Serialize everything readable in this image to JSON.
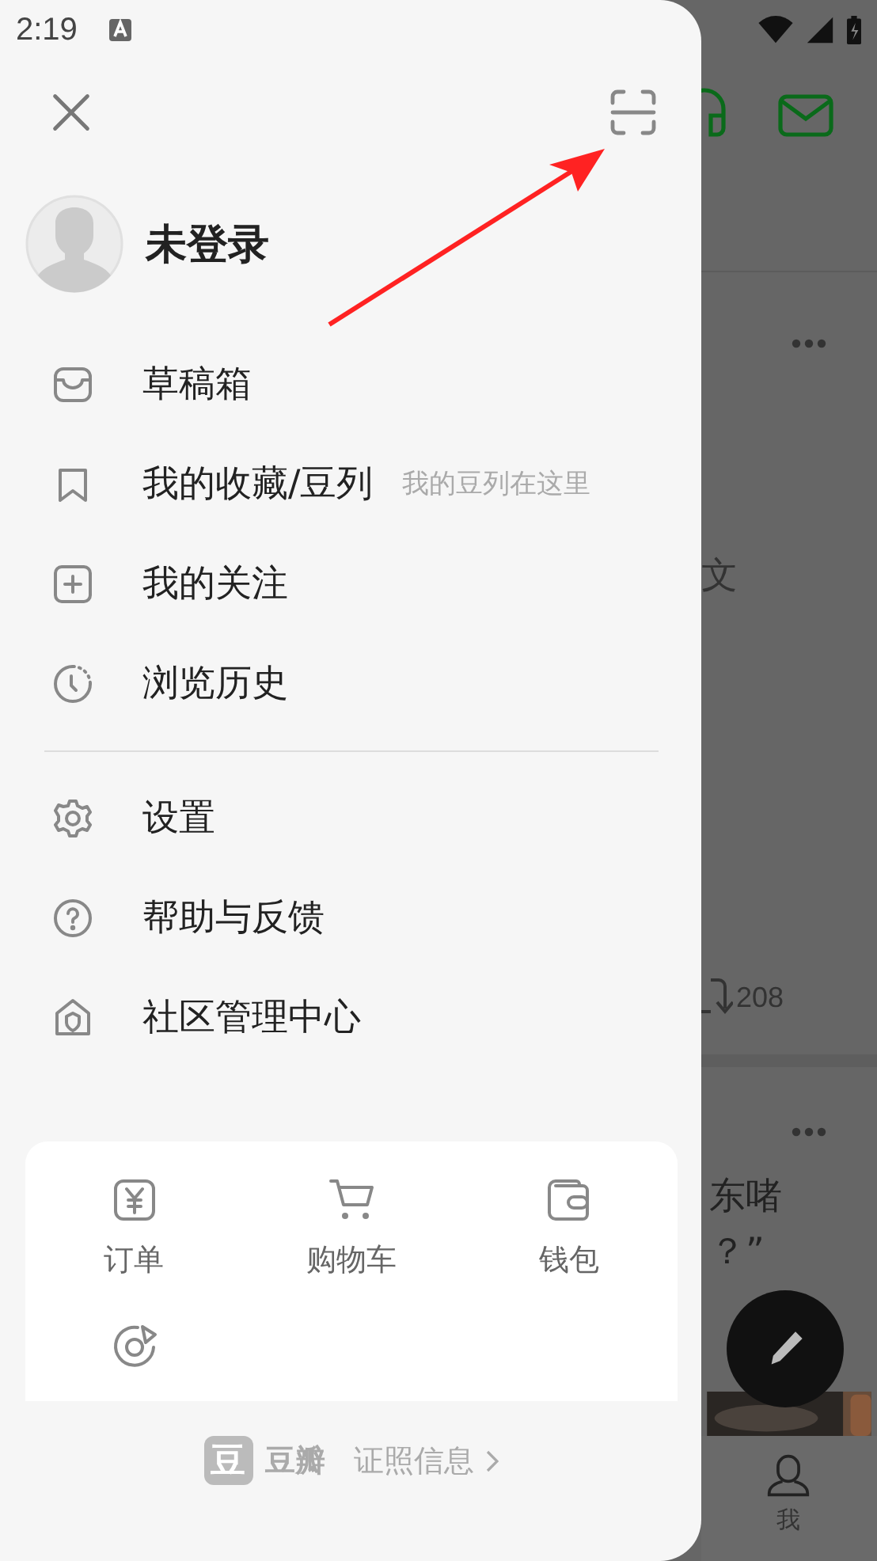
{
  "status_bar": {
    "time": "2:19"
  },
  "drawer": {
    "user": {
      "name": "未登录"
    },
    "menu": [
      {
        "kind": "drafts",
        "label": "草稿箱"
      },
      {
        "kind": "bookmark",
        "label": "我的收藏/豆列",
        "hint": "我的豆列在这里"
      },
      {
        "kind": "follow",
        "label": "我的关注"
      },
      {
        "kind": "history",
        "label": "浏览历史"
      }
    ],
    "menu_2": [
      {
        "kind": "settings",
        "label": "设置"
      },
      {
        "kind": "help",
        "label": "帮助与反馈"
      },
      {
        "kind": "community",
        "label": "社区管理中心"
      }
    ],
    "services": [
      {
        "kind": "order",
        "label": "订单"
      },
      {
        "kind": "cart",
        "label": "购物车"
      },
      {
        "kind": "wallet",
        "label": "钱包"
      },
      {
        "kind": "time"
      }
    ],
    "footer": {
      "logo": "豆",
      "brand": "豆瓣",
      "license": "证照信息"
    }
  },
  "background": {
    "texts": [
      {
        "kind": "article",
        "text": "文"
      },
      {
        "kind": "count",
        "text": "208"
      },
      {
        "kind": "line",
        "text": "东啫"
      },
      {
        "kind": "line",
        "text": "？”"
      }
    ],
    "tab_label": "我"
  }
}
